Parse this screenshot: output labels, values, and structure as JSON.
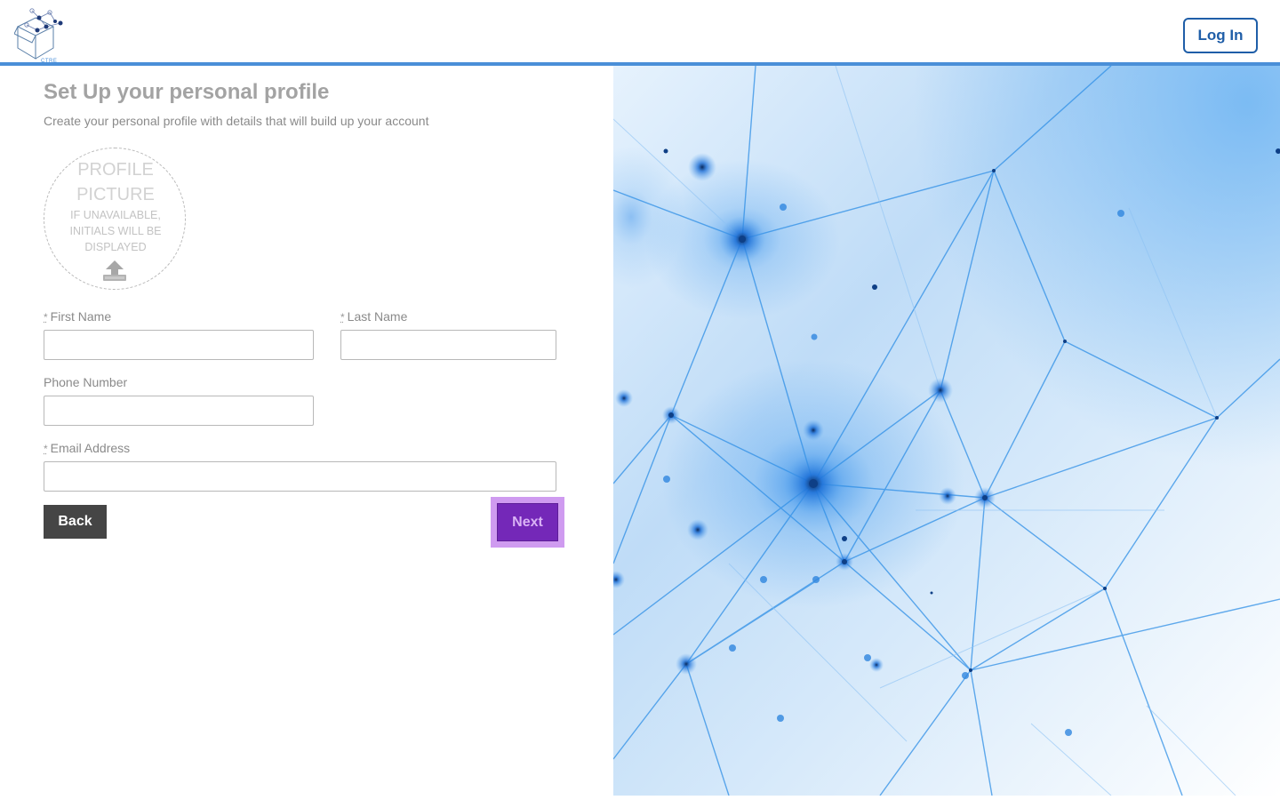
{
  "header": {
    "logo_text": "CTRE",
    "login_label": "Log In"
  },
  "form": {
    "title": "Set Up your personal profile",
    "subtitle": "Create your personal profile with details that will build up your account",
    "avatar": {
      "title": "PROFILE PICTURE",
      "note": "IF UNAVAILABLE, INITIALS WILL BE DISPLAYED",
      "icon": "upload-icon"
    },
    "required_mark": "*",
    "fields": {
      "first_name": {
        "label": "First Name",
        "value": ""
      },
      "last_name": {
        "label": "Last Name",
        "value": ""
      },
      "phone": {
        "label": "Phone Number",
        "value": ""
      },
      "email": {
        "label": "Email Address",
        "value": ""
      }
    },
    "back_label": "Back",
    "next_label": "Next"
  },
  "colors": {
    "header_rule": "#4a8fd8",
    "login_border": "#1f5ea8",
    "back_bg": "#454545",
    "next_bg": "#7428b8",
    "next_highlight": "#cf9bf0"
  }
}
